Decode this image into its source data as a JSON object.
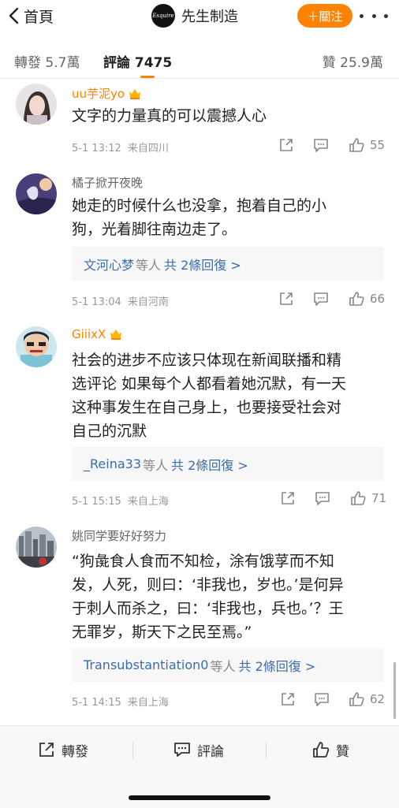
{
  "topnav": {
    "back_label": "首頁",
    "logo_text": "Esquire",
    "account_name": "先生制造",
    "follow_label": "＋關注"
  },
  "tabs": {
    "repost": "轉發 5.7萬",
    "comment": "評論 7475",
    "like": "贊 25.9萬"
  },
  "comments": [
    {
      "user": "uu芋泥yo",
      "vip": true,
      "lines": [
        "文字的力量真的可以震撼人心"
      ],
      "time": "5-1 13:12",
      "location": "来自四川",
      "likes": "55"
    },
    {
      "user": "橘子掀开夜晚",
      "vip": false,
      "lines": [
        "她走的时候什么也没拿，抱着自己的小",
        "狗，光着脚往南边走了。"
      ],
      "reply_user": "文河心梦",
      "reply_suffix": "等人",
      "reply_count": "共 2條回復 >",
      "time": "5-1 13:04",
      "location": "来自河南",
      "likes": "66"
    },
    {
      "user": "GiiixX",
      "vip": true,
      "lines": [
        "社会的进步不应该只体现在新闻联播和精",
        "选评论  如果每个人都看着她沉默，有一天",
        "这种事发生在自己身上，也要接受社会对",
        "自己的沉默"
      ],
      "reply_user": "_Reina33",
      "reply_suffix": "等人",
      "reply_count": "共 2條回復 >",
      "time": "5-1 15:15",
      "location": "来自上海",
      "likes": "71"
    },
    {
      "user": "姚同学要好好努力",
      "vip": false,
      "lines": [
        "“狗彘食人食而不知检，涂有饿莩而不知",
        "发，人死，则曰：‘非我也，岁也。’是何异",
        "于刺人而杀之，曰：‘非我也，兵也。’？王",
        "无罪岁，斯天下之民至焉。”"
      ],
      "reply_user": "Transubstantiation0",
      "reply_suffix": "等人",
      "reply_count": "共 2條回復 >",
      "time": "5-1 14:15",
      "location": "来自上海",
      "likes": "62"
    }
  ],
  "bottombar": {
    "repost": "轉發",
    "comment": "評論",
    "like": "贊"
  },
  "colors": {
    "accent": "#ff8200",
    "link": "#3b6cab",
    "vip_name": "#ff8200"
  }
}
